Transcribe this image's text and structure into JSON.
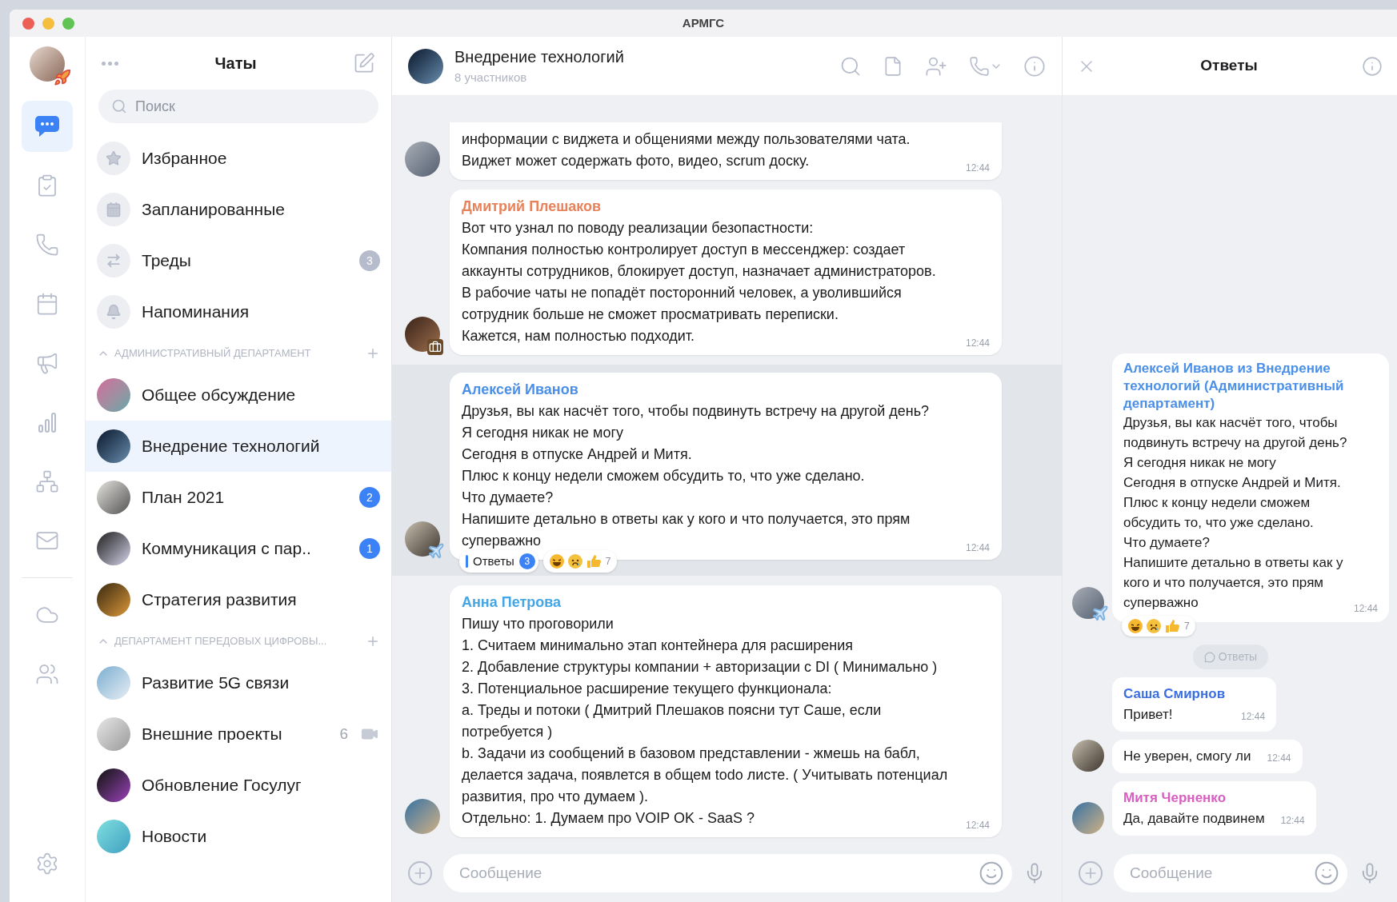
{
  "window": {
    "title": "АРМГС"
  },
  "rail": {
    "items": [
      {
        "selected": true
      },
      {
        "selected": false
      },
      {
        "selected": false
      },
      {
        "selected": false
      },
      {
        "selected": false
      },
      {
        "selected": false
      },
      {
        "selected": false
      },
      {
        "selected": false
      },
      {
        "selected": false
      },
      {
        "selected": false
      },
      {
        "selected": false
      }
    ]
  },
  "chat_list": {
    "title": "Чаты",
    "search": {
      "placeholder": "Поиск"
    },
    "shortcuts": [
      {
        "label": "Избранное"
      },
      {
        "label": "Запланированные"
      },
      {
        "label": "Треды",
        "badge": "3",
        "badge_muted": true
      },
      {
        "label": "Напоминания"
      }
    ],
    "sections": [
      {
        "title": "АДМИНИСТРАТИВНЫЙ ДЕПАРТАМЕНТ",
        "expanded": true,
        "chats": [
          {
            "name": "Общее обсуждение",
            "selected": false
          },
          {
            "name": "Внедрение технологий",
            "selected": true
          },
          {
            "name": "План 2021",
            "selected": false,
            "badge": "2",
            "badge_muted": false
          },
          {
            "name": "Коммуникация с пар..",
            "selected": false,
            "badge": "1",
            "badge_muted": false
          },
          {
            "name": "Стратегия развития",
            "selected": false
          }
        ]
      },
      {
        "title": "ДЕПАРТАМЕНТ ПЕРЕДОВЫХ ЦИФРОВЫ...",
        "expanded": true,
        "chats": [
          {
            "name": "Развитие 5G связи",
            "selected": false
          },
          {
            "name": "Внешние проекты",
            "selected": false,
            "count": "6",
            "video": true
          },
          {
            "name": "Обновление Госулуг",
            "selected": false
          },
          {
            "name": "Новости",
            "selected": false
          }
        ]
      }
    ]
  },
  "chat": {
    "title": "Внедрение технологий",
    "subtitle": "8 участников",
    "messages": [
      {
        "text": "информации с виджета и общениями между пользователями чата.\nВиджет может содержать фото, видео, scrum доску.",
        "time": "12:44",
        "highlighted": false,
        "on_trip": false,
        "at_work": false
      },
      {
        "sender": "Дмитрий Плешаков",
        "color": "#e8825a",
        "text": "Вот что узнал по поводу реализации безопастности:\nКомпания полностью контролирует доступ в мессенджер: создает аккаунты сотрудников, блокирует доступ, назначает администраторов.\nВ рабочие чаты не попадёт посторонний человек, а уволившийся сотрудник больше не сможет просматривать переписки.\nКажется, нам полностью подходит.",
        "time": "12:44",
        "highlighted": false,
        "on_trip": false,
        "at_work": true
      },
      {
        "sender": "Алексей Иванов",
        "color": "#4a8fe8",
        "text": "Друзья, вы как насчёт того, чтобы подвинуть встречу на другой день?\nЯ сегодня никак не могу\nСегодня в отпуске Андрей и Митя.\nПлюс к концу недели сможем обсудить то, что уже сделано.\nЧто думаете?\nНапишите детально в ответы как у кого и что получается, это прям суперважно",
        "time": "12:44",
        "highlighted": true,
        "on_trip": true,
        "at_work": false,
        "replies": {
          "label": "Ответы",
          "count": "3"
        },
        "reactions": {
          "count": "7"
        }
      },
      {
        "sender": "Анна Петрова",
        "color": "#45a6e6",
        "text": "Пишу что проговорили\n1. Считаем минимально этап контейнера для расширения\n2. Добавление структуры компании + авторизации с DI ( Минимально )\n3. Потенциальное расширение текущего функционала:\na. Треды и потоки ( Дмитрий Плешаков поясни тут Саше, если потребуется )\nb. Задачи из сообщений в базовом представлении - жмешь на бабл, делается задача, появлется в общем todo листе. ( Учитывать потенциал развития, про что думаем ).\nОтдельно: 1. Думаем про VOIP OK - SaaS ?",
        "time": "12:44",
        "highlighted": false,
        "on_trip": false,
        "at_work": false
      }
    ],
    "composer": {
      "placeholder": "Сообщение"
    }
  },
  "thread": {
    "title": "Ответы",
    "root": {
      "sender": "Алексей Иванов из Внедрение технологий (Административный департамент)",
      "color": "#4a8fe8",
      "text": "Друзья, вы как насчёт того, чтобы подвинуть встречу на другой день?\nЯ сегодня никак не могу\nСегодня в отпуске Андрей и Митя.\nПлюс к концу недели сможем обсудить то, что уже сделано.\nЧто думаете?\nНапишите детально в ответы как у кого и что получается, это прям суперважно",
      "time": "12:44",
      "on_trip": true,
      "reactions": {
        "count": "7"
      }
    },
    "divider": "Ответы",
    "replies": [
      {
        "sender": "Саша Смирнов",
        "color": "#3b6fe0",
        "text": "Привет!",
        "time": "12:44",
        "avatar": false
      },
      {
        "text": "Не уверен, смогу ли",
        "time": "12:44",
        "avatar": true
      },
      {
        "sender": "Митя Черненко",
        "color": "#d65fbf",
        "text": "Да, давайте подвинем",
        "time": "12:44",
        "avatar": true
      }
    ],
    "composer": {
      "placeholder": "Сообщение"
    }
  }
}
